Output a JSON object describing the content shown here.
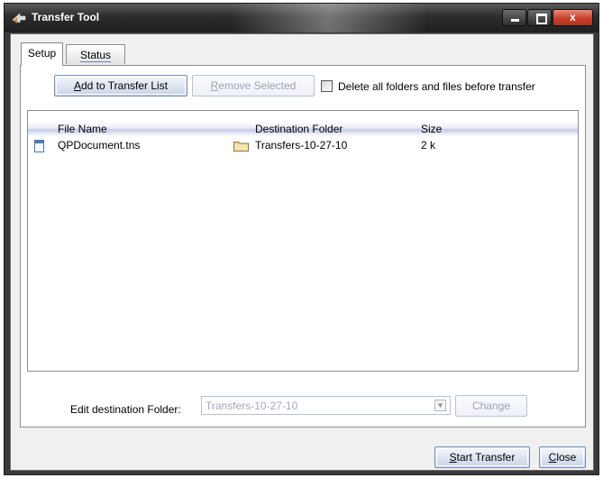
{
  "window": {
    "title": "Transfer Tool",
    "controls": {
      "minimize": "minimize",
      "maximize": "maximize",
      "close": "x"
    }
  },
  "tabs": [
    {
      "label": "Setup",
      "selected": true
    },
    {
      "label": "Status",
      "selected": false
    }
  ],
  "toolbar": {
    "add_label_mnemonic": "A",
    "add_label_rest": "dd to Transfer List",
    "remove_label_mnemonic": "R",
    "remove_label_rest": "emove Selected",
    "remove_enabled": false,
    "delete_checkbox_label": "Delete all folders and files before transfer",
    "delete_checked": false
  },
  "table": {
    "columns": [
      "File Name",
      "Destination Folder",
      "Size"
    ],
    "rows": [
      {
        "file": "QPDocument.tns",
        "destination": "Transfers-10-27-10",
        "size": "2 k",
        "file_icon": "document-icon",
        "folder_icon": "folder-icon"
      }
    ]
  },
  "destination": {
    "label": "Edit destination Folder:",
    "value": "Transfers-10-27-10",
    "enabled": false,
    "change_label": "Change"
  },
  "footer": {
    "start_mnemonic": "S",
    "start_rest": "tart Transfer",
    "close_mnemonic": "C",
    "close_rest": "lose"
  },
  "colors": {
    "title_bar": "#2c2c2c",
    "close_button": "#c6402a",
    "button_gradient_bottom": "#c8d3e8",
    "header_stripe": "#c3cbe8"
  }
}
